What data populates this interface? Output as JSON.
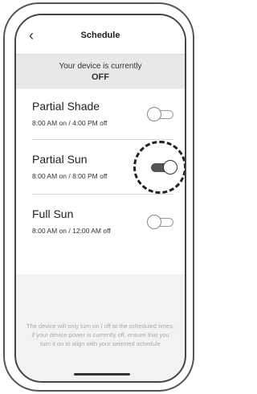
{
  "header": {
    "back_icon": "chevron-left-icon",
    "back_glyph": "‹",
    "title": "Schedule"
  },
  "status": {
    "line1": "Your device is currently",
    "line2": "OFF"
  },
  "schedules": [
    {
      "name": "Partial Shade",
      "time": "8:00 AM on / 4:00 PM off",
      "enabled": false
    },
    {
      "name": "Partial Sun",
      "time": "8:00 AM on / 8:00 PM off",
      "enabled": true
    },
    {
      "name": "Full Sun",
      "time": "8:00 AM on / 12:00 AM off",
      "enabled": false
    }
  ],
  "note": "The device will only turn on / off at the scheduled times, if your device power is currently off, ensure that you turn it on to align with your selected schedule"
}
